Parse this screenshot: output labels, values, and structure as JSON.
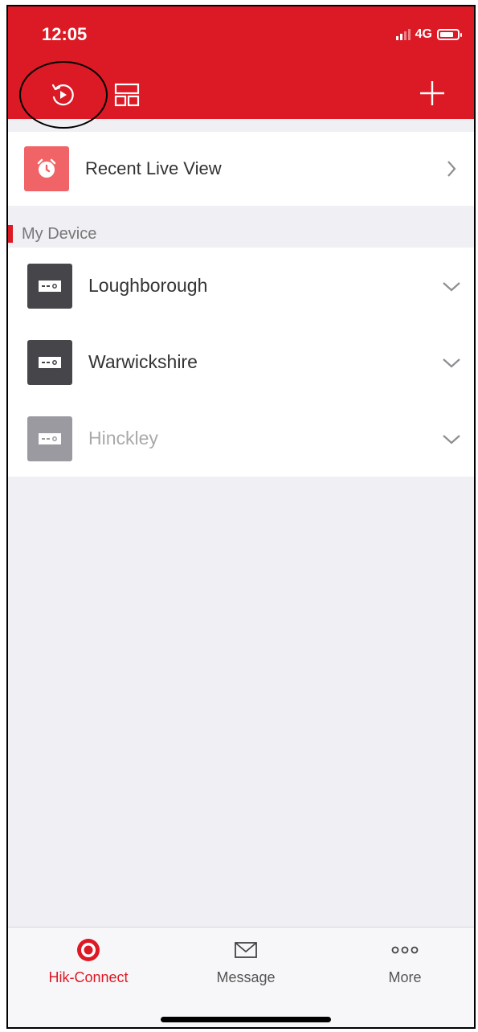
{
  "status_bar": {
    "time": "12:05",
    "network": "4G"
  },
  "header": {
    "icons": [
      "playback-icon",
      "layout-icon",
      "add-icon"
    ],
    "color": "#dc1a25"
  },
  "recent": {
    "label": "Recent Live View",
    "icon": "alarm-clock-icon",
    "color": "#f06468"
  },
  "section": {
    "label": "My Device"
  },
  "devices": [
    {
      "name": "Loughborough",
      "status": "online"
    },
    {
      "name": "Warwickshire",
      "status": "online"
    },
    {
      "name": "Hinckley",
      "status": "offline"
    }
  ],
  "tabbar": {
    "tabs": [
      {
        "label": "Hik-Connect",
        "icon": "target-icon",
        "active": true
      },
      {
        "label": "Message",
        "icon": "envelope-icon",
        "active": false
      },
      {
        "label": "More",
        "icon": "more-dots-icon",
        "active": false
      }
    ]
  }
}
